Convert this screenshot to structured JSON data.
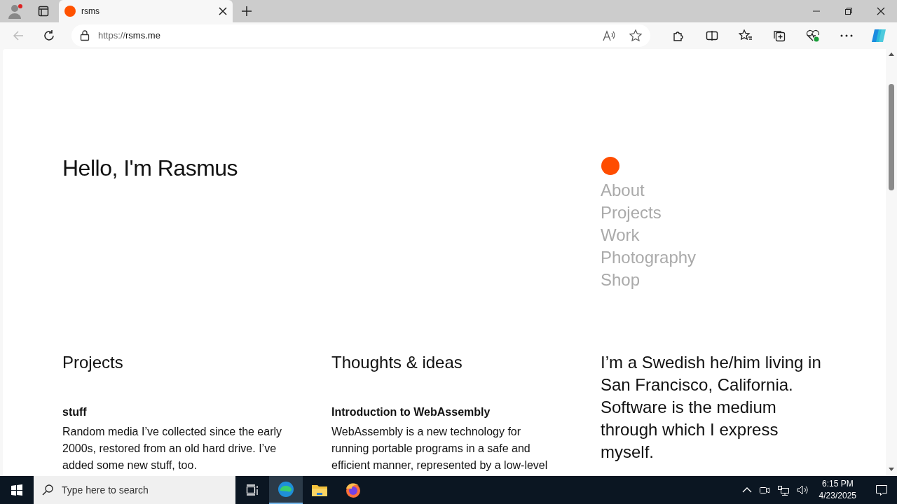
{
  "browser": {
    "tab_title": "rsms",
    "url_scheme": "https://",
    "url_host": "rsms.me"
  },
  "page": {
    "heading": "Hello, I'm Rasmus",
    "nav": [
      {
        "label": "About"
      },
      {
        "label": "Projects"
      },
      {
        "label": "Work"
      },
      {
        "label": "Photography"
      },
      {
        "label": "Shop"
      }
    ],
    "sections": [
      {
        "title": "Projects",
        "items": [
          {
            "title": "stuff",
            "text": "Random media I’ve collected since the early 2000s, restored from an old hard drive. I’ve added some new stuff, too."
          }
        ]
      },
      {
        "title": "Thoughts & ideas",
        "items": [
          {
            "title": "Introduction to WebAssembly",
            "text": "WebAssembly is a new technology for running portable programs in a safe and efficient manner, represented by a low-level"
          }
        ]
      }
    ],
    "bio": "I’m a Swedish he/him living in San Francisco, California. Software is the medium through which I express myself."
  },
  "taskbar": {
    "search_placeholder": "Type here to search",
    "time": "6:15 PM",
    "date": "4/23/2025"
  }
}
